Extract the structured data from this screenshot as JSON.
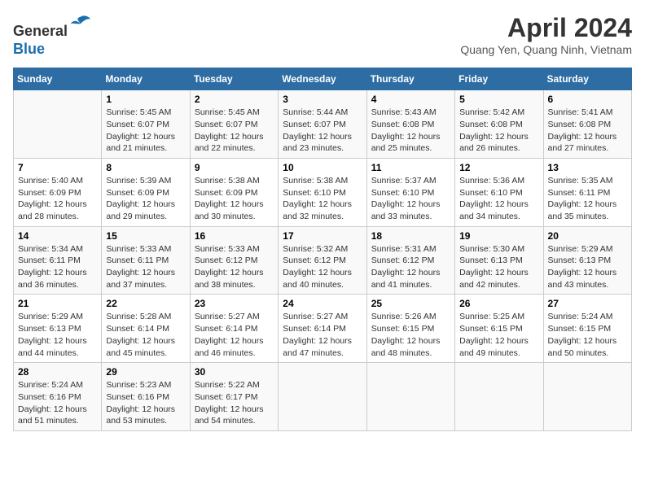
{
  "header": {
    "logo_line1": "General",
    "logo_line2": "Blue",
    "title": "April 2024",
    "subtitle": "Quang Yen, Quang Ninh, Vietnam"
  },
  "calendar": {
    "days_of_week": [
      "Sunday",
      "Monday",
      "Tuesday",
      "Wednesday",
      "Thursday",
      "Friday",
      "Saturday"
    ],
    "weeks": [
      [
        {
          "day": "",
          "info": ""
        },
        {
          "day": "1",
          "info": "Sunrise: 5:45 AM\nSunset: 6:07 PM\nDaylight: 12 hours\nand 21 minutes."
        },
        {
          "day": "2",
          "info": "Sunrise: 5:45 AM\nSunset: 6:07 PM\nDaylight: 12 hours\nand 22 minutes."
        },
        {
          "day": "3",
          "info": "Sunrise: 5:44 AM\nSunset: 6:07 PM\nDaylight: 12 hours\nand 23 minutes."
        },
        {
          "day": "4",
          "info": "Sunrise: 5:43 AM\nSunset: 6:08 PM\nDaylight: 12 hours\nand 25 minutes."
        },
        {
          "day": "5",
          "info": "Sunrise: 5:42 AM\nSunset: 6:08 PM\nDaylight: 12 hours\nand 26 minutes."
        },
        {
          "day": "6",
          "info": "Sunrise: 5:41 AM\nSunset: 6:08 PM\nDaylight: 12 hours\nand 27 minutes."
        }
      ],
      [
        {
          "day": "7",
          "info": "Sunrise: 5:40 AM\nSunset: 6:09 PM\nDaylight: 12 hours\nand 28 minutes."
        },
        {
          "day": "8",
          "info": "Sunrise: 5:39 AM\nSunset: 6:09 PM\nDaylight: 12 hours\nand 29 minutes."
        },
        {
          "day": "9",
          "info": "Sunrise: 5:38 AM\nSunset: 6:09 PM\nDaylight: 12 hours\nand 30 minutes."
        },
        {
          "day": "10",
          "info": "Sunrise: 5:38 AM\nSunset: 6:10 PM\nDaylight: 12 hours\nand 32 minutes."
        },
        {
          "day": "11",
          "info": "Sunrise: 5:37 AM\nSunset: 6:10 PM\nDaylight: 12 hours\nand 33 minutes."
        },
        {
          "day": "12",
          "info": "Sunrise: 5:36 AM\nSunset: 6:10 PM\nDaylight: 12 hours\nand 34 minutes."
        },
        {
          "day": "13",
          "info": "Sunrise: 5:35 AM\nSunset: 6:11 PM\nDaylight: 12 hours\nand 35 minutes."
        }
      ],
      [
        {
          "day": "14",
          "info": "Sunrise: 5:34 AM\nSunset: 6:11 PM\nDaylight: 12 hours\nand 36 minutes."
        },
        {
          "day": "15",
          "info": "Sunrise: 5:33 AM\nSunset: 6:11 PM\nDaylight: 12 hours\nand 37 minutes."
        },
        {
          "day": "16",
          "info": "Sunrise: 5:33 AM\nSunset: 6:12 PM\nDaylight: 12 hours\nand 38 minutes."
        },
        {
          "day": "17",
          "info": "Sunrise: 5:32 AM\nSunset: 6:12 PM\nDaylight: 12 hours\nand 40 minutes."
        },
        {
          "day": "18",
          "info": "Sunrise: 5:31 AM\nSunset: 6:12 PM\nDaylight: 12 hours\nand 41 minutes."
        },
        {
          "day": "19",
          "info": "Sunrise: 5:30 AM\nSunset: 6:13 PM\nDaylight: 12 hours\nand 42 minutes."
        },
        {
          "day": "20",
          "info": "Sunrise: 5:29 AM\nSunset: 6:13 PM\nDaylight: 12 hours\nand 43 minutes."
        }
      ],
      [
        {
          "day": "21",
          "info": "Sunrise: 5:29 AM\nSunset: 6:13 PM\nDaylight: 12 hours\nand 44 minutes."
        },
        {
          "day": "22",
          "info": "Sunrise: 5:28 AM\nSunset: 6:14 PM\nDaylight: 12 hours\nand 45 minutes."
        },
        {
          "day": "23",
          "info": "Sunrise: 5:27 AM\nSunset: 6:14 PM\nDaylight: 12 hours\nand 46 minutes."
        },
        {
          "day": "24",
          "info": "Sunrise: 5:27 AM\nSunset: 6:14 PM\nDaylight: 12 hours\nand 47 minutes."
        },
        {
          "day": "25",
          "info": "Sunrise: 5:26 AM\nSunset: 6:15 PM\nDaylight: 12 hours\nand 48 minutes."
        },
        {
          "day": "26",
          "info": "Sunrise: 5:25 AM\nSunset: 6:15 PM\nDaylight: 12 hours\nand 49 minutes."
        },
        {
          "day": "27",
          "info": "Sunrise: 5:24 AM\nSunset: 6:15 PM\nDaylight: 12 hours\nand 50 minutes."
        }
      ],
      [
        {
          "day": "28",
          "info": "Sunrise: 5:24 AM\nSunset: 6:16 PM\nDaylight: 12 hours\nand 51 minutes."
        },
        {
          "day": "29",
          "info": "Sunrise: 5:23 AM\nSunset: 6:16 PM\nDaylight: 12 hours\nand 53 minutes."
        },
        {
          "day": "30",
          "info": "Sunrise: 5:22 AM\nSunset: 6:17 PM\nDaylight: 12 hours\nand 54 minutes."
        },
        {
          "day": "",
          "info": ""
        },
        {
          "day": "",
          "info": ""
        },
        {
          "day": "",
          "info": ""
        },
        {
          "day": "",
          "info": ""
        }
      ]
    ]
  }
}
